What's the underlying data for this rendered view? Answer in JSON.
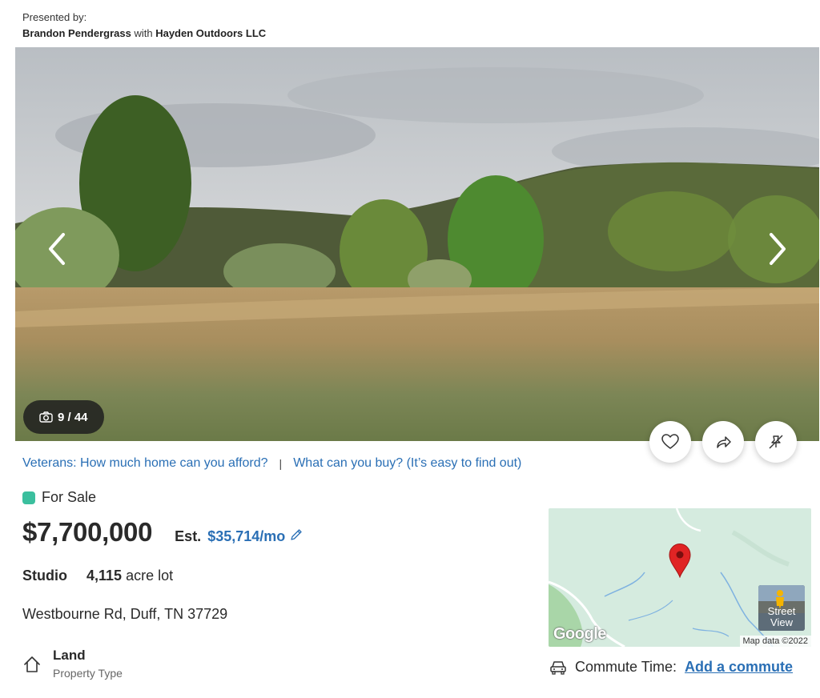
{
  "presenter": {
    "label": "Presented by:",
    "agent": "Brandon Pendergrass",
    "with": "with",
    "brokerage": "Hayden Outdoors LLC"
  },
  "gallery": {
    "counter": "9 / 44",
    "current": 9,
    "total": 44
  },
  "actions": {
    "favorite_icon": "heart-icon",
    "share_icon": "share-icon",
    "hide_icon": "hide-icon"
  },
  "links": {
    "veterans": "Veterans: How much home can you afford?",
    "separator": "|",
    "what_buy": "What can you buy? (It’s easy to find out)"
  },
  "listing": {
    "status": "For Sale",
    "status_color": "#3bbf9e",
    "price": "$7,700,000",
    "est_label": "Est.",
    "est_payment": "$35,714/mo",
    "beds": "Studio",
    "lot_value": "4,115",
    "lot_unit": "acre lot",
    "address": "Westbourne Rd, Duff, TN 37729",
    "property_type_value": "Land",
    "property_type_label": "Property Type"
  },
  "map": {
    "logo": "Google",
    "attribution": "Map data ©2022",
    "street_view": "Street View"
  },
  "commute": {
    "label": "Commute Time:",
    "link": "Add a commute"
  },
  "colors": {
    "link": "#2a6fb5",
    "text": "#2a2a2a"
  }
}
